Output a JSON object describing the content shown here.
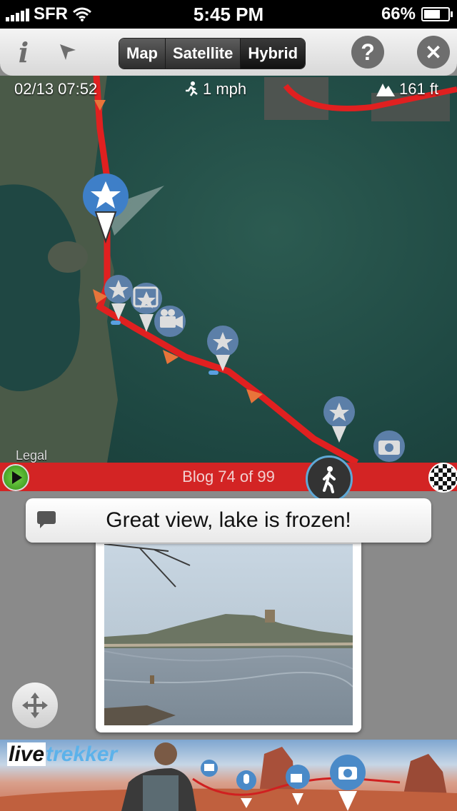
{
  "status_bar": {
    "carrier": "SFR",
    "time": "5:45 PM",
    "battery": "66%"
  },
  "toolbar": {
    "segments": [
      "Map",
      "Satellite",
      "Hybrid"
    ],
    "selected_segment": "Hybrid",
    "help_label": "?",
    "close_label": "✕"
  },
  "map": {
    "date_time": "02/13 07:52",
    "speed": "1 mph",
    "altitude": "161 ft",
    "legal": "Legal",
    "route_color": "#e02020"
  },
  "timeline": {
    "label": "Blog 74 of 99",
    "accent": "#d32424"
  },
  "comment": {
    "text": "Great view, lake is frozen!"
  },
  "banner": {
    "logo_live": "live",
    "logo_trekker": "trekker"
  },
  "icons": [
    "info-icon",
    "locate-arrow-icon",
    "help-icon",
    "close-icon",
    "run-icon",
    "mountain-icon",
    "play-icon",
    "walker-icon",
    "finish-flag-icon",
    "comment-icon",
    "move-icon"
  ]
}
